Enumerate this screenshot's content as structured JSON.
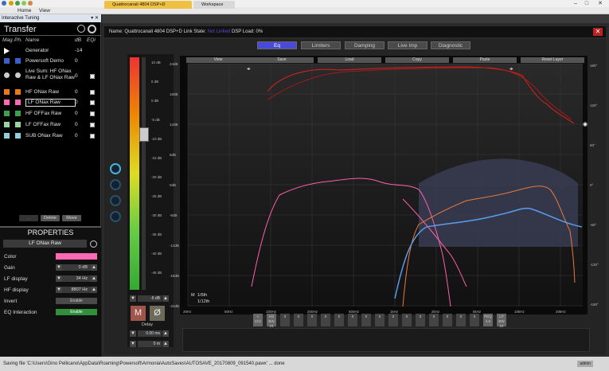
{
  "menubar": {
    "home": "Home",
    "view": "View"
  },
  "panel_tab": {
    "label": "Interactive Tuning"
  },
  "transfer": {
    "title": "Transfer",
    "hdr_mag": "Mag.",
    "hdr_ph": "Ph.",
    "hdr_name": "Name",
    "hdr_db": "dB",
    "hdr_eqi": "EQi",
    "rows": [
      {
        "name": "Generator",
        "db": "-14"
      },
      {
        "name": "Powersoft Demo",
        "db": "0"
      },
      {
        "name": "Live Sum: HF ONax Raw & LF ONax Raw",
        "db": "0"
      },
      {
        "name": "HF ONax Raw",
        "db": "0"
      },
      {
        "name": "LF ONax Raw",
        "db": "0"
      },
      {
        "name": "HF OFFax Raw",
        "db": "0"
      },
      {
        "name": "LF OFFax Raw",
        "db": "0"
      },
      {
        "name": "SUB ONax Raw",
        "db": "0"
      }
    ],
    "btn_delete": "Delete",
    "btn_move": "Move"
  },
  "properties": {
    "title": "PROPERTIES",
    "selected": "LF ONax Raw",
    "color_label": "Color",
    "gain_label": "Gain",
    "gain_value": "0 dB",
    "lf_label": "LF display",
    "lf_value": "34 Hz",
    "hf_label": "HF display",
    "hf_value": "8807 Hz",
    "invert_label": "Invert",
    "invert_btn": "Enable",
    "eqi_label": "EQ Interaction",
    "eqi_btn": "Enable"
  },
  "doctabs": {
    "tab1": "Quattrocanali 4804 DSP+D",
    "tab2": "Workspace"
  },
  "namebar": {
    "prefix": "Name:",
    "device": "Quattrocanali 4804 DSP+D",
    "link_label": "Link State:",
    "link_value": "Not Linked",
    "dsp_label": "DSP Load:",
    "dsp_value": "0%"
  },
  "eqtabs": [
    "Eq",
    "Limiters",
    "Damping",
    "Live Imp",
    "Diagnostic"
  ],
  "toolbar": [
    "View",
    "Save",
    "Load",
    "Copy",
    "Paste",
    "Reset Layer"
  ],
  "fader": {
    "value": "-6 dB",
    "labels": [
      "10 dB",
      "5 dB",
      "0 dB",
      "-5 dB",
      "-10 dB",
      "-15 dB",
      "-20 dB",
      "-25 dB",
      "-30 dB",
      "-35 dB",
      "-40 dB",
      "-45 dB"
    ]
  },
  "buttons": {
    "mute": "M",
    "phase": "Ø",
    "delay_label": "Delay",
    "delay_ms": "0.00 ms",
    "delay_m": "0 m"
  },
  "graph": {
    "left_ticks": [
      "24dB",
      "18dB",
      "12dB",
      "6dB",
      "0dB",
      "-6dB",
      "-12dB",
      "-18dB",
      "-24dB"
    ],
    "right_ticks": [
      "180°",
      "120°",
      "60°",
      "0°",
      "-60°",
      "-120°",
      "-180°"
    ],
    "x_ticks": [
      "20Hz",
      "50Hz",
      "100Hz",
      "200Hz",
      "500Hz",
      "1kHz",
      "2kHz",
      "5kHz",
      "10kHz",
      "20kHz"
    ],
    "m_label": "M",
    "m_val1": "1/6th",
    "m_val2": "1/12th"
  },
  "channels": [
    "< Ch1",
    "HS BW 24",
    "0",
    "0",
    "0",
    "0",
    "0",
    "0",
    "0",
    "0",
    "0",
    "0",
    "0",
    "0",
    "0",
    "0",
    "0",
    "PEQ 4.5",
    "LP BW 24"
  ],
  "status": {
    "text": "Saving file 'C:\\Users\\Gino Pellicano\\AppData\\Roaming\\Powersoft\\Armonia\\AutoSaves\\AUTOSAVE_20170809_091540.pawx' ... done",
    "user": "admin"
  }
}
